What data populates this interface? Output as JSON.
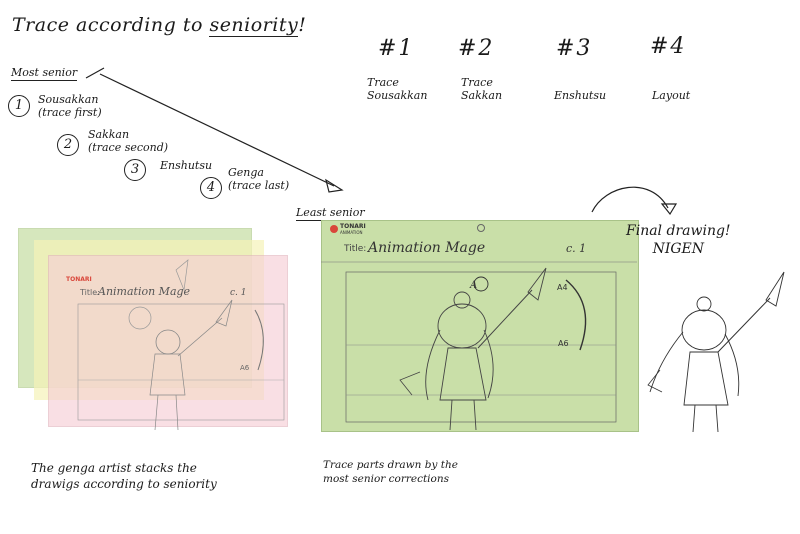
{
  "title": {
    "prefix": "Trace according to ",
    "underlined": "seniority",
    "suffix": "!"
  },
  "most_senior_label": "Most senior",
  "least_senior_label": "Least senior",
  "steps": [
    {
      "num": "1",
      "name": "Sousakkan",
      "note": "(trace first)"
    },
    {
      "num": "2",
      "name": "Sakkan",
      "note": "(trace second)"
    },
    {
      "num": "3",
      "name": "Enshutsu",
      "note": ""
    },
    {
      "num": "4",
      "name": "Genga",
      "note": "(trace last)"
    }
  ],
  "columns": [
    {
      "number": "#1",
      "line1": "Trace",
      "line2": "Sousakkan"
    },
    {
      "number": "#2",
      "line1": "Trace",
      "line2": "Sakkan"
    },
    {
      "number": "#3",
      "line1": "Enshutsu",
      "line2": ""
    },
    {
      "number": "#4",
      "line1": "Layout",
      "line2": ""
    }
  ],
  "sheet": {
    "brand": "TONARI",
    "brand_sub": "ANIMATION",
    "title_label": "Title:",
    "title_value": "Animation Mage",
    "cut_label": "c. 1"
  },
  "final": {
    "line1": "Final drawing!",
    "line2": "NIGEN"
  },
  "captions": {
    "left_line1": "The genga artist stacks the",
    "left_line2": "drawigs according to seniority",
    "mid_line1": "Trace parts drawn by the",
    "mid_line2": "most senior corrections"
  },
  "colors": {
    "green": "#c9dfa8",
    "yellow": "#f5f2b8",
    "pink": "#f6cfd6",
    "sheet_logo": "#d9463a"
  }
}
